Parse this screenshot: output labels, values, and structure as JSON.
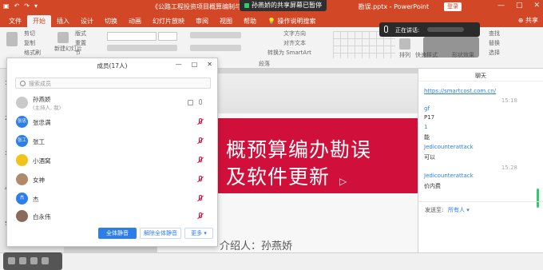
{
  "window": {
    "title": "《公路工程投资项目概算编制与审查》",
    "subtitle": "勘误.pptx - PowerPoint",
    "share_banner": "孙燕娇的共享屏幕已暂停",
    "login": "登录",
    "controls": [
      "—",
      "□",
      "✕"
    ]
  },
  "ribbon": {
    "tabs": [
      "文件",
      "开始",
      "插入",
      "设计",
      "切换",
      "动画",
      "幻灯片放映",
      "审阅",
      "视图",
      "帮助",
      "操作说明搜索"
    ],
    "active_tab": "开始",
    "share": "共享",
    "clipboard": [
      "剪切",
      "复制",
      "格式刷"
    ],
    "slides": [
      "新建幻灯片",
      "版式",
      "重置",
      "节"
    ],
    "text_tools": [
      "文字方向",
      "对齐文本",
      "转换为 SmartArt"
    ],
    "paragraph_label": "段落",
    "arrange": "排列",
    "quick_styles": "快速样式",
    "editing": [
      "查找",
      "替换",
      "选择"
    ],
    "shape_fill": "形状填充",
    "shape_outline": "形状轮廓",
    "shape_effect": "形状效果"
  },
  "speaking": {
    "label": "正在讲话:"
  },
  "thumbnails": [
    "1",
    "2",
    "3",
    "4",
    "5"
  ],
  "slide": {
    "title_line1": "概预算编办勘误",
    "title_line2": "及软件更新",
    "presenter": "介绍人：孙燕娇"
  },
  "members": {
    "title": "成员(17人)",
    "search_placeholder": "搜索成员",
    "list": [
      {
        "name": "孙燕娇",
        "role": "(主持人, 我)",
        "avatar_text": "",
        "avatar_color": "#c9c9c9",
        "muted": false
      },
      {
        "name": "张忠满",
        "role": "",
        "avatar_text": "张忠满",
        "avatar_color": "#2d7ee8",
        "muted": true
      },
      {
        "name": "张工",
        "role": "",
        "avatar_text": "张工",
        "avatar_color": "#2d7ee8",
        "muted": true
      },
      {
        "name": "小酒窝",
        "role": "",
        "avatar_text": "",
        "avatar_color": "#f0c419",
        "muted": true
      },
      {
        "name": "女神",
        "role": "",
        "avatar_text": "",
        "avatar_color": "#b08a6a",
        "muted": true
      },
      {
        "name": "杰",
        "role": "",
        "avatar_text": "杰",
        "avatar_color": "#2d7ee8",
        "muted": true
      },
      {
        "name": "白永伟",
        "role": "",
        "avatar_text": "",
        "avatar_color": "#8a6a5a",
        "muted": true
      }
    ],
    "btn_mute_all": "全体静音",
    "btn_unmute_all": "解除全体静音",
    "btn_more": "更多 ▾"
  },
  "chat": {
    "title": "聊天",
    "link": "https://smartcost.com.cn/",
    "time1": "15:18",
    "msgs_a": [
      {
        "text": "gf",
        "cls": "blue"
      },
      {
        "text": "P17",
        "cls": ""
      },
      {
        "text": "1",
        "cls": "blue"
      },
      {
        "text": "能",
        "cls": ""
      },
      {
        "text": "Jedicounterattack",
        "cls": "blue"
      },
      {
        "text": "可以",
        "cls": ""
      }
    ],
    "time2": "15:28",
    "msgs_b": [
      {
        "text": "Jedicounterattack",
        "cls": "blue"
      },
      {
        "text": "价内费",
        "cls": ""
      }
    ],
    "send_label": "发送至:",
    "send_target": "所有人 ▾"
  }
}
